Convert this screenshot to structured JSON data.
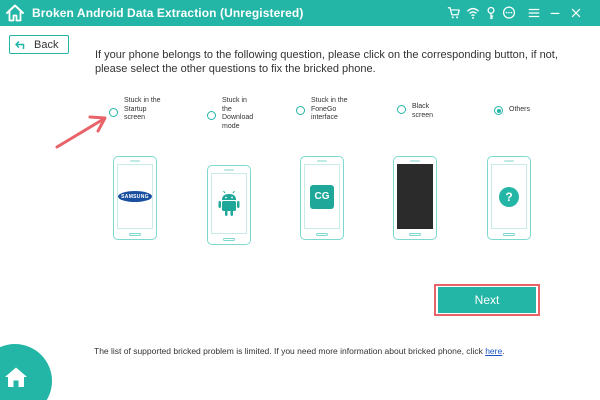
{
  "window": {
    "title": "Broken Android Data Extraction (Unregistered)",
    "icons": [
      "home-icon",
      "cart-icon",
      "wifi-icon",
      "key-icon",
      "chat-icon",
      "menu-icon",
      "minimize-icon",
      "close-icon"
    ],
    "accent_color": "#23b5a6",
    "highlight_color": "#e8636a"
  },
  "back": {
    "label": "Back"
  },
  "instruction": "If your phone belongs to the following question, please click on the corresponding button, if not, please select the other questions to fix the bricked phone.",
  "options": [
    {
      "label": "Stuck in the\nStartup\nscreen",
      "selected": false,
      "image": "samsung-logo"
    },
    {
      "label": "Stuck in\nthe\nDownload\nmode",
      "selected": false,
      "image": "android-logo"
    },
    {
      "label": "Stuck in the\nFoneGo\ninterface",
      "selected": false,
      "image": "fonego-logo"
    },
    {
      "label": "Black\nscreen",
      "selected": false,
      "image": "black-screen"
    },
    {
      "label": "Others",
      "selected": true,
      "image": "question-icon"
    }
  ],
  "images": {
    "samsung_text": "SAMSUNG",
    "fonego_text": "CG",
    "question_text": "?"
  },
  "next": {
    "label": "Next"
  },
  "note": {
    "text": "The list of supported bricked problem is limited. If you need more information about bricked phone, click ",
    "link": "here",
    "suffix": "."
  }
}
